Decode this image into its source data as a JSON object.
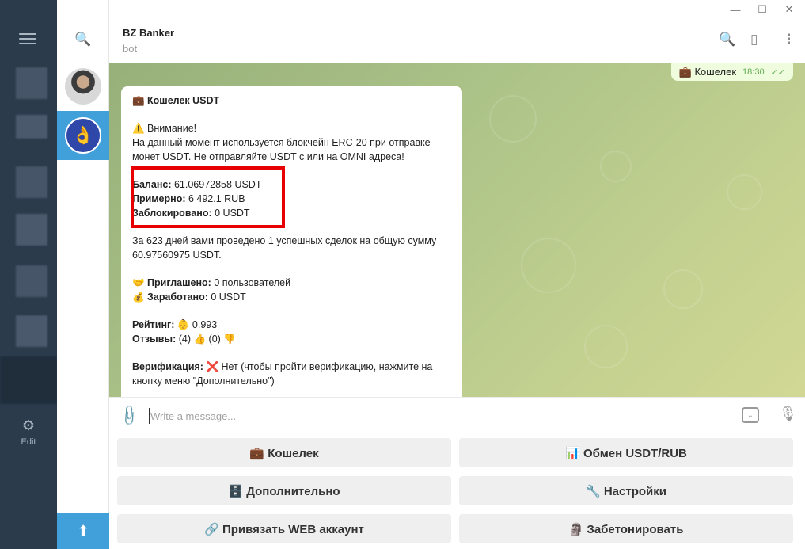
{
  "window": {
    "minimize": "—",
    "maximize": "☐",
    "close": "✕"
  },
  "sidebar": {
    "edit_label": "Edit",
    "edit_icon": "sliders-icon"
  },
  "chat": {
    "title": "BZ Banker",
    "subtitle": "bot",
    "outgoing": {
      "text": "💼 Кошелек",
      "time": "18:30",
      "status": "✓✓"
    }
  },
  "message": {
    "title": "💼 Кошелек USDT",
    "warning_title": "⚠️ Внимание!",
    "warning_text": "На данный момент используется блокчейн ERC-20 при отправке монет USDT. Не отправляйте USDT с или на OMNI адреса!",
    "balance_label": "Баланс:",
    "balance_value": " 61.06972858 USDT",
    "approx_label": "Примерно:",
    "approx_value": " 6 492.1 RUB",
    "blocked_label": "Заблокировано:",
    "blocked_value": " 0 USDT",
    "deals_text": "За 623 дней вами проведено 1 успешных сделок на общую сумму 60.97560975 USDT.",
    "invited_label": "🤝 Приглашено:",
    "invited_value": " 0 пользователей",
    "earned_label": "💰 Заработано:",
    "earned_value": " 0 USDT",
    "rating_label": "Рейтинг:",
    "rating_value": " 👶 0.993",
    "reviews_label": "Отзывы:",
    "reviews_value": " (4) 👍 (0) 👎",
    "verification_label": "Верификация:",
    "verification_value": " ❌ Нет (чтобы пройти верификацию, нажмите на кнопку меню \"Дополнительно\")"
  },
  "input": {
    "placeholder": "Write a message..."
  },
  "keyboard": [
    {
      "label": "💼 Кошелек"
    },
    {
      "label": "📊 Обмен USDT/RUB"
    },
    {
      "label": "🗄️ Дополнительно"
    },
    {
      "label": "🔧 Настройки"
    },
    {
      "label": "🔗 Привязать WEB аккаунт"
    },
    {
      "label": "🗿 Забетонировать"
    }
  ],
  "colors": {
    "accent": "#419fd9",
    "highlight": "#e60000",
    "sidebar": "#2b3b4c"
  }
}
